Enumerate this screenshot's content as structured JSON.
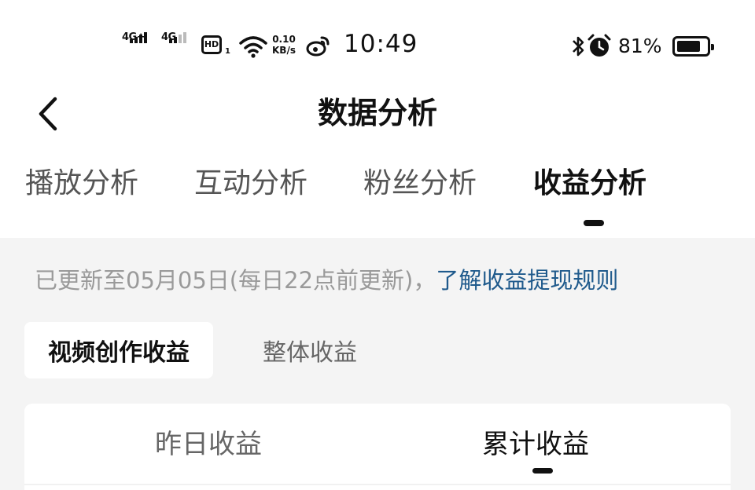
{
  "status_bar": {
    "signal1_label": "4G+",
    "signal2_label": "4G",
    "hd_label": "HD",
    "hd_sub": "1",
    "speed_value": "0.10",
    "speed_unit": "KB/s",
    "time": "10:49",
    "battery_percent": "81%",
    "battery_level": 0.81
  },
  "header": {
    "title": "数据分析"
  },
  "tabs": [
    {
      "label": "播放分析",
      "active": false
    },
    {
      "label": "互动分析",
      "active": false
    },
    {
      "label": "粉丝分析",
      "active": false
    },
    {
      "label": "收益分析",
      "active": true
    }
  ],
  "notice": {
    "text": "已更新至05月05日(每日22点前更新)，",
    "link": "了解收益提现规则"
  },
  "segments": [
    {
      "label": "视频创作收益",
      "active": true
    },
    {
      "label": "整体收益",
      "active": false
    }
  ],
  "earnings_tabs": [
    {
      "label": "昨日收益",
      "active": false
    },
    {
      "label": "累计收益",
      "active": true
    }
  ],
  "colors": {
    "link": "#1f5a8c",
    "background": "#f4f4f4",
    "text": "#111111"
  },
  "icons": [
    "signal-icon",
    "hd-icon",
    "wifi-icon",
    "weibo-icon",
    "bluetooth-icon",
    "alarm-icon",
    "battery-icon",
    "back-arrow-icon"
  ]
}
